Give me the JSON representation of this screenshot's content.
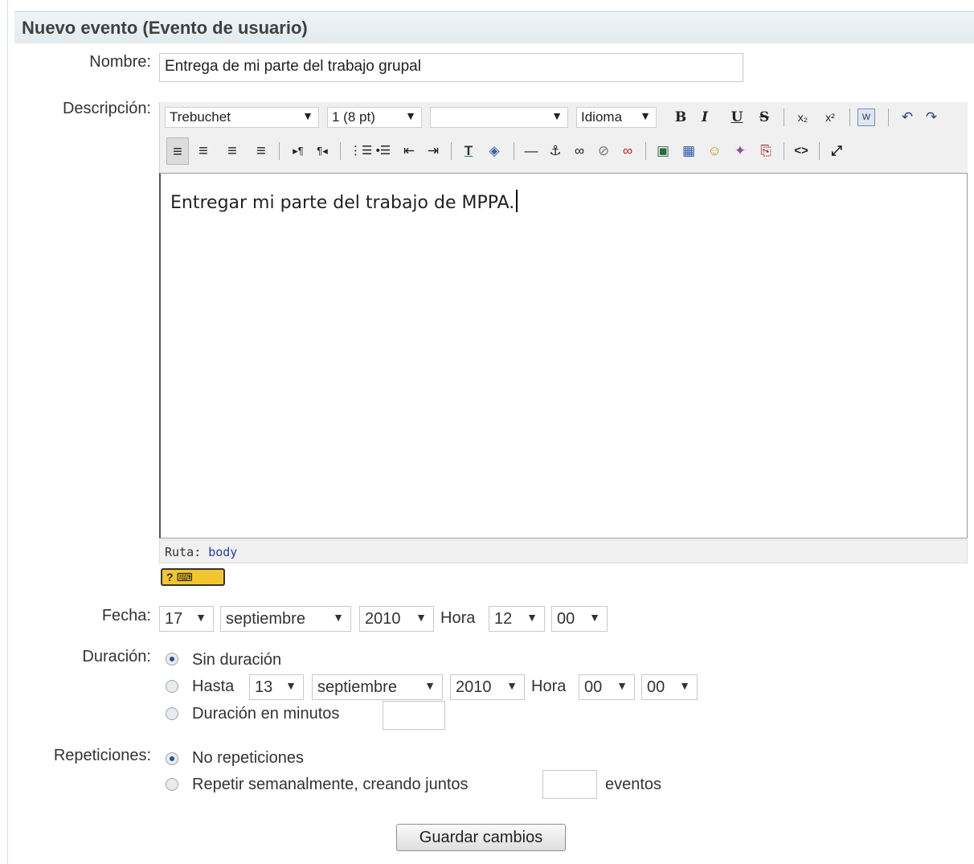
{
  "header": {
    "title": "Nuevo evento (Evento de usuario)"
  },
  "form": {
    "nombre_label": "Nombre:",
    "nombre_value": "Entrega de mi parte del trabajo grupal",
    "descripcion_label": "Descripción:",
    "fecha_label": "Fecha:",
    "duracion_label": "Duración:",
    "repeticiones_label": "Repeticiones:"
  },
  "editor": {
    "font_select": "Trebuchet",
    "size_select": "1 (8 pt)",
    "format_select": "",
    "language_select": "Idioma",
    "content": "Entregar mi parte del trabajo de MPPA.",
    "path_label": "Ruta:",
    "path_value": "body",
    "keyboard_help": "? ⌨",
    "toolbar_row1": {
      "bold": "B",
      "italic": "I",
      "underline": "U",
      "strike": "S",
      "subscript": "x₂",
      "superscript": "x²",
      "paste_word": "W",
      "undo": "↶",
      "redo": "↷"
    },
    "toolbar_row2": {
      "align_left": "≡",
      "align_center": "≡",
      "align_right": "≡",
      "justify": "≡",
      "ltr": "▸¶",
      "rtl": "¶◂",
      "ordered_list": "⋮☰",
      "unordered_list": "•☰",
      "outdent": "⇤",
      "indent": "⇥",
      "text_color": "T",
      "bg_color": "◈",
      "hr": "—",
      "anchor": "⚓",
      "link": "∞",
      "unlink": "⊘",
      "nolink": "∞",
      "image": "▣",
      "table": "▦",
      "smiley": "☺",
      "special_char": "✦",
      "search": "⎘",
      "html_source": "<>",
      "fullscreen": "⤢"
    }
  },
  "fecha": {
    "day": "17",
    "month": "septiembre",
    "year": "2010",
    "hora_label": "Hora",
    "hour": "12",
    "minute": "00"
  },
  "duracion": {
    "option1": "Sin duración",
    "option2_label": "Hasta",
    "until_day": "13",
    "until_month": "septiembre",
    "until_year": "2010",
    "hora_label": "Hora",
    "until_hour": "00",
    "until_minute": "00",
    "option3": "Duración en minutos",
    "minutes_value": ""
  },
  "repeticiones": {
    "option1": "No repeticiones",
    "option2": "Repetir semanalmente, creando juntos",
    "count_value": "",
    "eventos_label": "eventos"
  },
  "save_button": "Guardar cambios"
}
